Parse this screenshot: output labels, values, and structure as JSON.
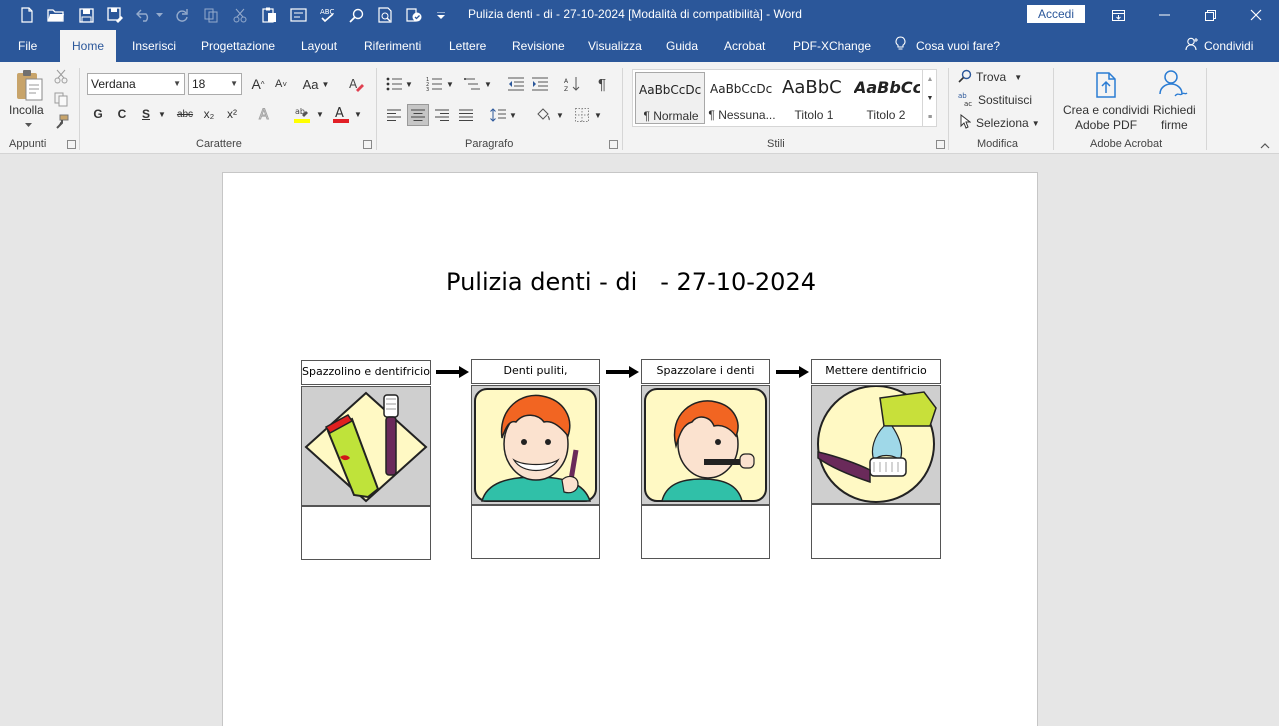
{
  "window": {
    "title": "Pulizia denti - di  - 27-10-2024 [Modalità di compatibilità]  -  Word",
    "signin_label": "Accedi"
  },
  "tabs": [
    "File",
    "Home",
    "Inserisci",
    "Progettazione",
    "Layout",
    "Riferimenti",
    "Lettere",
    "Revisione",
    "Visualizza",
    "Guida",
    "Acrobat",
    "PDF-XChange"
  ],
  "active_tab": "Home",
  "tell_me": "Cosa vuoi fare?",
  "share_label": "Condividi",
  "ribbon": {
    "clipboard": {
      "paste_label": "Incolla",
      "group_label": "Appunti"
    },
    "font": {
      "font_name": "Verdana",
      "font_size": "18",
      "group_label": "Carattere",
      "bold": "G",
      "italic": "C",
      "underline": "S",
      "strike": "abc",
      "sub": "x₂",
      "sup": "x²",
      "case": "Aa",
      "grow": "A",
      "shrink": "A"
    },
    "paragraph": {
      "group_label": "Paragrafo"
    },
    "styles": {
      "group_label": "Stili",
      "items": [
        {
          "preview": "AaBbCcDc",
          "name": "¶ Normale"
        },
        {
          "preview": "AaBbCcDc",
          "name": "¶ Nessuna..."
        },
        {
          "preview": "AaBbC",
          "name": "Titolo 1"
        },
        {
          "preview": "AaBbCc",
          "name": "Titolo 2"
        }
      ]
    },
    "editing": {
      "group_label": "Modifica",
      "find": "Trova",
      "replace": "Sostituisci",
      "select": "Seleziona"
    },
    "acrobat": {
      "group_label": "Adobe Acrobat",
      "create_line1": "Crea e condividi",
      "create_line2": "Adobe PDF",
      "sign_line1": "Richiedi",
      "sign_line2": "firme"
    }
  },
  "document": {
    "title": "Pulizia denti - di   - 27-10-2024",
    "steps": [
      {
        "label": "Spazzolino e dentifricio",
        "picture": "toothbrush-and-toothpaste"
      },
      {
        "label": "Denti puliti,",
        "picture": "boy-smiling-clean-teeth"
      },
      {
        "label": "Spazzolare i denti",
        "picture": "boy-brushing-teeth"
      },
      {
        "label": "Mettere dentifricio",
        "picture": "toothpaste-on-brush"
      }
    ]
  },
  "colors": {
    "accent": "#2b579a",
    "ribbon_bg": "#f3f3f3",
    "doc_bg": "#e6e6e6"
  }
}
